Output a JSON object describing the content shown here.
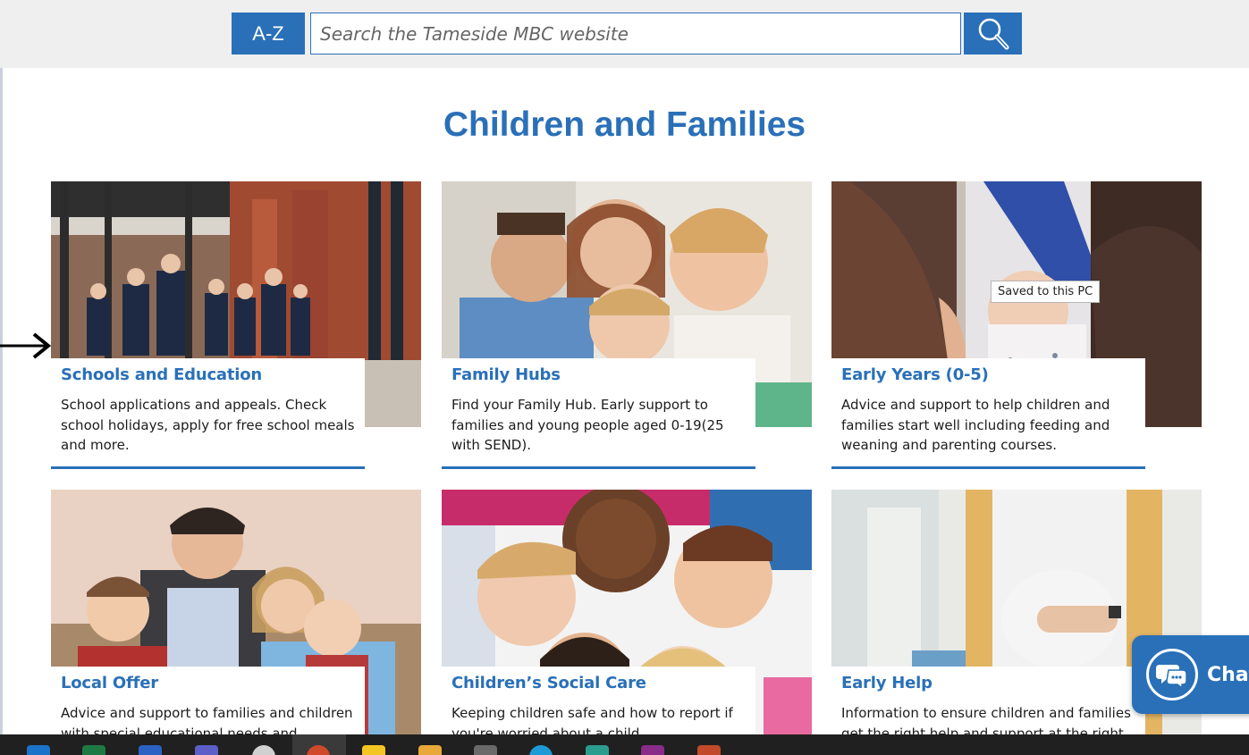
{
  "header": {
    "az_label": "A-Z",
    "search_placeholder": "Search the Tameside MBC website"
  },
  "page_title": "Children and Families",
  "cards": [
    {
      "title": "Schools and Education",
      "description": "School applications and appeals. Check school holidays, apply for free school meals and more."
    },
    {
      "title": "Family Hubs",
      "description": "Find your Family Hub. Early support to families and young people aged 0-19(25 with SEND)."
    },
    {
      "title": "Early Years (0-5)",
      "description": "Advice and support to help children and families start well including feeding and weaning and parenting courses."
    },
    {
      "title": "Local Offer",
      "description": "Advice and support to families and children with special educational needs and disabilities."
    },
    {
      "title": "Children’s Social Care",
      "description": "Keeping children safe and how to report if you're worried about a child."
    },
    {
      "title": "Early Help",
      "description": "Information to ensure children and families get the right help and support at the right time."
    }
  ],
  "tooltip": "Saved to this PC",
  "chat": {
    "label": "Chat"
  },
  "colors": {
    "brand_blue": "#2a70b8",
    "header_grey": "#efefef",
    "taskbar": "#202020"
  },
  "icons": {
    "search": "magnifier-icon",
    "chat": "chat-bubbles-icon",
    "pointer": "arrow-right-icon"
  }
}
